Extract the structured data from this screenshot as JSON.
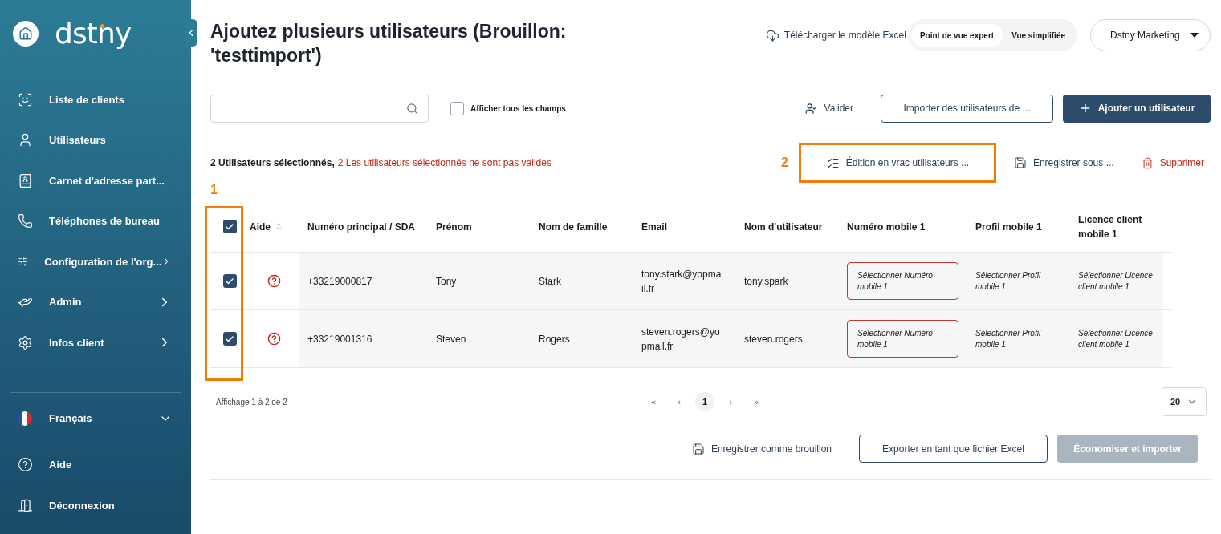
{
  "sidebar": {
    "logo": "dstny",
    "items": [
      {
        "label": "Liste de clients",
        "chevron": false
      },
      {
        "label": "Utilisateurs",
        "chevron": false
      },
      {
        "label": "Carnet d'adresse part...",
        "chevron": false
      },
      {
        "label": "Téléphones de bureau",
        "chevron": false
      },
      {
        "label": "Configuration de l'org...",
        "chevron": true
      },
      {
        "label": "Admin",
        "chevron": true
      },
      {
        "label": "Infos client",
        "chevron": true
      }
    ],
    "language": {
      "label": "Français",
      "expanded": false
    },
    "bottom_items": [
      {
        "label": "Aide"
      },
      {
        "label": "Déconnexion"
      }
    ]
  },
  "header": {
    "title": "Ajoutez plusieurs utilisateurs (Brouillon: 'testtimport')",
    "download_link": "Télécharger le modèle Excel",
    "view_toggle": [
      {
        "label": "Point de vue expert",
        "selected": true
      },
      {
        "label": "Vue simplifiée",
        "selected": false
      }
    ],
    "account": "Dstny Marketing"
  },
  "toolbar": {
    "show_all_fields": {
      "label": "Afficher tous les champs",
      "checked": false
    },
    "validate": "Valider",
    "import": "Importer des utilisateurs de ...",
    "add": "Ajouter un utilisateur"
  },
  "selection": {
    "count_text": "2 Utilisateurs sélectionnés,",
    "error_text": "2 Les utilisateurs sélectionnés ne sont pas valides",
    "bulk_edit": "Édition en vrac utilisateurs ...",
    "save_as": "Enregistrer sous ...",
    "delete": "Supprimer"
  },
  "annotations": [
    {
      "label": "1"
    },
    {
      "label": "2"
    }
  ],
  "table": {
    "select_all_checked": true,
    "columns": [
      {
        "label": "Aide",
        "sortable": true
      },
      {
        "label": "Numéro principal / SDA",
        "sortable": false
      },
      {
        "label": "Prénom",
        "sortable": false
      },
      {
        "label": "Nom de famille",
        "sortable": false
      },
      {
        "label": "Email",
        "sortable": false
      },
      {
        "label": "Nom d'utilisateur",
        "sortable": false
      },
      {
        "label": "Numéro mobile 1",
        "sortable": false
      },
      {
        "label": "Profil mobile 1",
        "sortable": false
      },
      {
        "label": "Licence client mobile 1",
        "sortable": false
      }
    ],
    "rows": [
      {
        "checked": true,
        "phone": "+33219000817",
        "first_name": "Tony",
        "last_name": "Stark",
        "email": "tony.stark@yopmail.fr",
        "username": "tony.spark",
        "mobile_number": {
          "placeholder": "Sélectionner Numéro mobile 1",
          "invalid": true
        },
        "mobile_profile": "Sélectionner Profil mobile 1",
        "mobile_license": "Sélectionner Licence client mobile 1"
      },
      {
        "checked": true,
        "phone": "+33219001316",
        "first_name": "Steven",
        "last_name": "Rogers",
        "email": "steven.rogers@yopmail.fr",
        "username": "steven.rogers",
        "mobile_number": {
          "placeholder": "Sélectionner Numéro mobile 1",
          "invalid": true
        },
        "mobile_profile": "Sélectionner Profil mobile 1",
        "mobile_license": "Sélectionner Licence client mobile 1"
      }
    ]
  },
  "pagination": {
    "summary": "Affichage 1 à 2 de 2",
    "pages": [
      {
        "label": "«",
        "selected": false
      },
      {
        "label": "‹",
        "selected": false
      },
      {
        "label": "1",
        "selected": true
      },
      {
        "label": "›",
        "selected": false
      },
      {
        "label": "»",
        "selected": false
      }
    ],
    "page_size": "20"
  },
  "footer": {
    "save_draft": "Enregistrer comme brouillon",
    "export": "Exporter en tant que fichier Excel",
    "save_import": {
      "label": "Économiser et importer",
      "disabled": true
    }
  }
}
